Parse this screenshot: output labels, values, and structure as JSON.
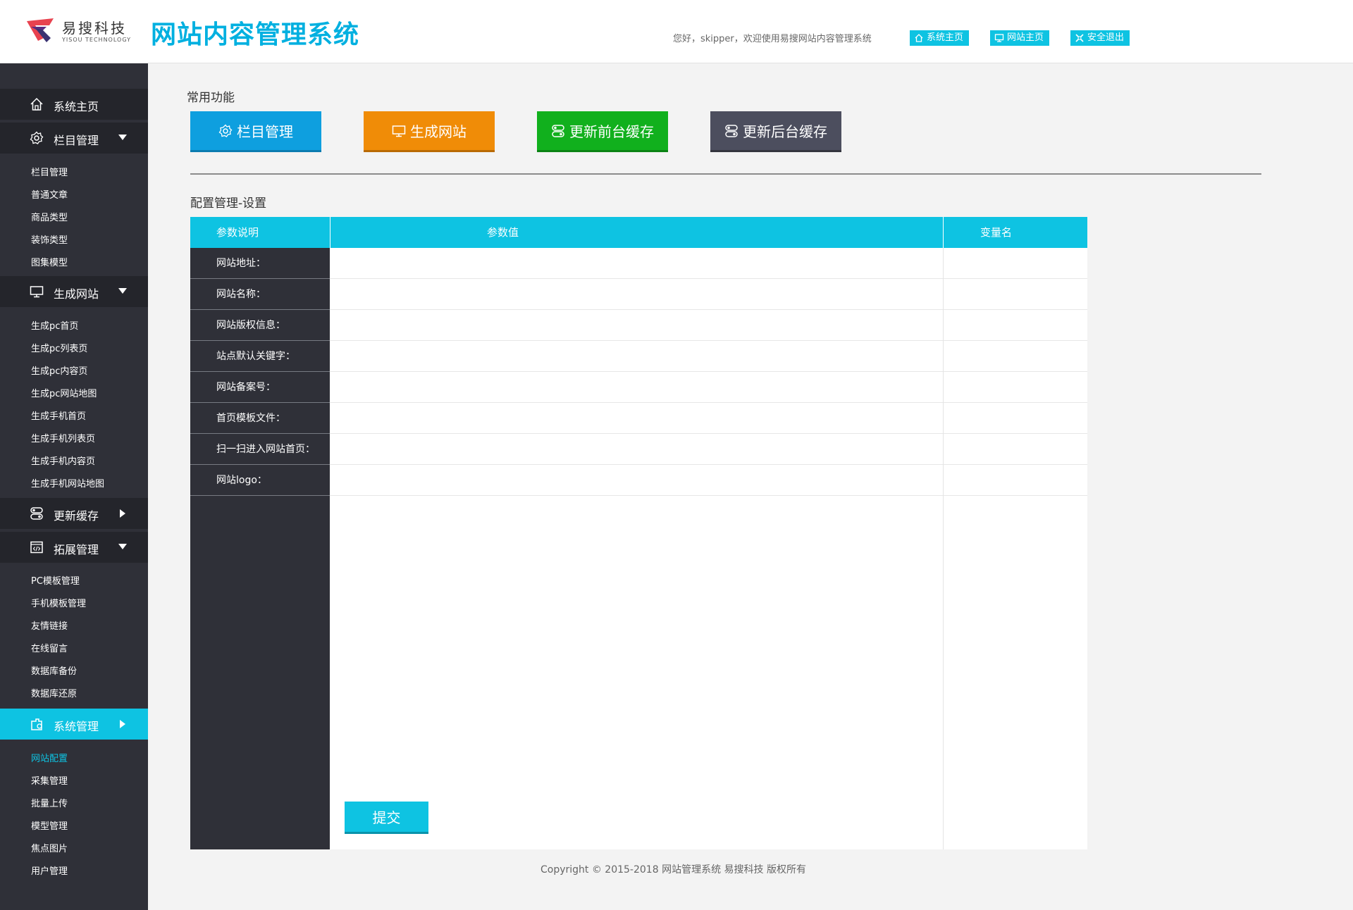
{
  "header": {
    "logo_cn": "易搜科技",
    "logo_en": "YISOU TECHNOLOGY",
    "title": "网站内容管理系统",
    "welcome": "您好，skipper，欢迎使用易搜网站内容管理系统",
    "links": [
      {
        "label": "系统主页",
        "icon": "home-icon"
      },
      {
        "label": "网站主页",
        "icon": "monitor-icon"
      },
      {
        "label": "安全退出",
        "icon": "exit-icon"
      }
    ]
  },
  "sidebar": {
    "home": {
      "label": "系统主页",
      "icon": "home-icon"
    },
    "groups": [
      {
        "label": "栏目管理",
        "icon": "gear-icon",
        "expanded": true,
        "items": [
          "栏目管理",
          "普通文章",
          "商品类型",
          "装饰类型",
          "图集模型"
        ]
      },
      {
        "label": "生成网站",
        "icon": "monitor-icon",
        "expanded": true,
        "items": [
          "生成pc首页",
          "生成pc列表页",
          "生成pc内容页",
          "生成pc网站地图",
          "生成手机首页",
          "生成手机列表页",
          "生成手机内容页",
          "生成手机网站地图"
        ]
      },
      {
        "label": "更新缓存",
        "icon": "toggle-icon",
        "expanded": false,
        "items": []
      },
      {
        "label": "拓展管理",
        "icon": "code-window-icon",
        "expanded": true,
        "items": [
          "PC模板管理",
          "手机模板管理",
          "友情链接",
          "在线留言",
          "数据库备份",
          "数据库还原"
        ]
      },
      {
        "label": "系统管理",
        "icon": "system-icon",
        "expanded": false,
        "active": true,
        "items": [
          "网站配置",
          "采集管理",
          "批量上传",
          "模型管理",
          "焦点图片",
          "用户管理"
        ],
        "active_item": "网站配置"
      }
    ]
  },
  "quick": {
    "title": "常用功能",
    "buttons": [
      {
        "label": "栏目管理",
        "icon": "gear-icon",
        "color": "#0e9fdf",
        "border": "#0b7cb0"
      },
      {
        "label": "生成网站",
        "icon": "monitor-icon",
        "color": "#f08c07",
        "border": "#b96a03"
      },
      {
        "label": "更新前台缓存",
        "icon": "toggle-icon",
        "color": "#11b01d",
        "border": "#0b8314"
      },
      {
        "label": "更新后台缓存",
        "icon": "toggle-icon",
        "color": "#4c4e5e",
        "border": "#35363f"
      }
    ]
  },
  "config": {
    "title": "配置管理-设置",
    "columns": [
      "参数说明",
      "参数值",
      "变量名"
    ],
    "rows": [
      {
        "label": "网站地址：",
        "value": "",
        "var": ""
      },
      {
        "label": "网站名称：",
        "value": "",
        "var": ""
      },
      {
        "label": "网站版权信息：",
        "value": "",
        "var": ""
      },
      {
        "label": "站点默认关键字：",
        "value": "",
        "var": ""
      },
      {
        "label": "网站备案号：",
        "value": "",
        "var": ""
      },
      {
        "label": "首页模板文件：",
        "value": "",
        "var": ""
      },
      {
        "label": "扫一扫进入网站首页：",
        "value": "",
        "var": ""
      },
      {
        "label": "网站logo：",
        "value": "",
        "var": ""
      }
    ],
    "submit": "提交"
  },
  "footer": {
    "copyright": "Copyright © 2015-2018 网站管理系统 易搜科技 版权所有"
  },
  "colors": {
    "accent": "#0ec3e2",
    "sidebar_bg": "#2f3038",
    "sidebar_group_bg": "#24252b"
  }
}
